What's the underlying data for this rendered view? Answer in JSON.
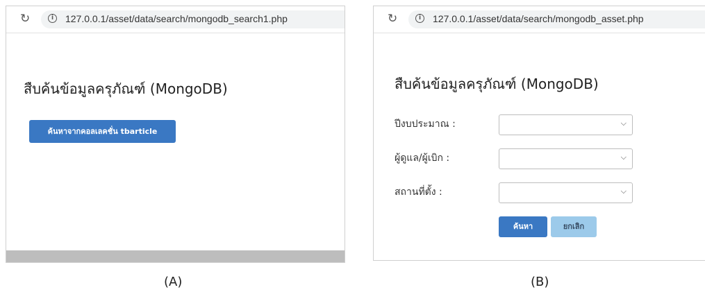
{
  "panel_a": {
    "url": "127.0.0.1/asset/data/search/mongodb_search1.php",
    "title": "สืบค้นข้อมูลครุภัณฑ์ (MongoDB)",
    "search_button_label": "ค้นหาจากคอลเลคชั่น tbarticle",
    "caption": "(A)"
  },
  "panel_b": {
    "url": "127.0.0.1/asset/data/search/mongodb_asset.php",
    "title": "สืบค้นข้อมูลครุภัณฑ์ (MongoDB)",
    "fields": [
      {
        "label": "ปีงบประมาณ :",
        "value": ""
      },
      {
        "label": "ผู้ดูแล/ผู้เบิก :",
        "value": ""
      },
      {
        "label": "สถานที่ตั้ง :",
        "value": ""
      }
    ],
    "search_label": "ค้นหา",
    "cancel_label": "ยกเลิก",
    "caption": "(B)"
  },
  "icons": {
    "reload": "reload-icon",
    "info": "info-icon",
    "dropdown": "chevron-down-icon"
  },
  "colors": {
    "primary_button": "#3a78c3",
    "cancel_button": "#9ccaea"
  }
}
